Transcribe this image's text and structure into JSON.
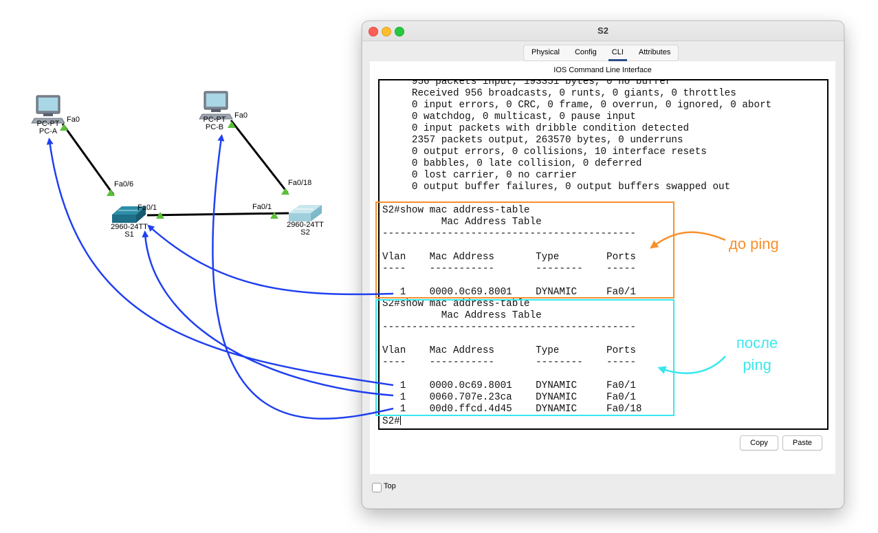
{
  "topology": {
    "pc_a": {
      "model": "PC-PT",
      "name": "PC-A",
      "port": "Fa0"
    },
    "pc_b": {
      "model": "PC-PT",
      "name": "PC-B",
      "port": "Fa0"
    },
    "s1": {
      "model": "2960-24TT",
      "name": "S1",
      "port_to_pc": "Fa0/6",
      "port_to_s2": "Fa0/1"
    },
    "s2": {
      "model": "2960-24TT",
      "name": "S2",
      "port_to_pc": "Fa0/18",
      "port_to_s1": "Fa0/1"
    }
  },
  "window": {
    "title": "S2",
    "tabs": [
      {
        "label": "Physical",
        "active": false
      },
      {
        "label": "Config",
        "active": false
      },
      {
        "label": "CLI",
        "active": true
      },
      {
        "label": "Attributes",
        "active": false
      }
    ],
    "panel_title": "IOS Command Line Interface",
    "copy_label": "Copy",
    "paste_label": "Paste",
    "top_label": "Top",
    "top_checked": false
  },
  "terminal": {
    "lines": [
      "     956 packets input, 193351 bytes, 0 no buffer",
      "     Received 956 broadcasts, 0 runts, 0 giants, 0 throttles",
      "     0 input errors, 0 CRC, 0 frame, 0 overrun, 0 ignored, 0 abort",
      "     0 watchdog, 0 multicast, 0 pause input",
      "     0 input packets with dribble condition detected",
      "     2357 packets output, 263570 bytes, 0 underruns",
      "     0 output errors, 0 collisions, 10 interface resets",
      "     0 babbles, 0 late collision, 0 deferred",
      "     0 lost carrier, 0 no carrier",
      "     0 output buffer failures, 0 output buffers swapped out",
      "",
      "S2#show mac address-table",
      "          Mac Address Table",
      "-------------------------------------------",
      "",
      "Vlan    Mac Address       Type        Ports",
      "----    -----------       --------    -----",
      "",
      "   1    0000.0c69.8001    DYNAMIC     Fa0/1",
      "S2#show mac address-table",
      "          Mac Address Table",
      "-------------------------------------------",
      "",
      "Vlan    Mac Address       Type        Ports",
      "----    -----------       --------    -----",
      "",
      "   1    0000.0c69.8001    DYNAMIC     Fa0/1",
      "   1    0060.707e.23ca    DYNAMIC     Fa0/1",
      "   1    00d0.ffcd.4d45    DYNAMIC     Fa0/18"
    ],
    "prompt": "S2#"
  },
  "annotations": {
    "before_label": "до ping",
    "after_label_line1": "после",
    "after_label_line2": "ping",
    "before_color": "#f7902b",
    "after_color": "#35e8ee",
    "arrow_color": "#1f3ff0"
  }
}
